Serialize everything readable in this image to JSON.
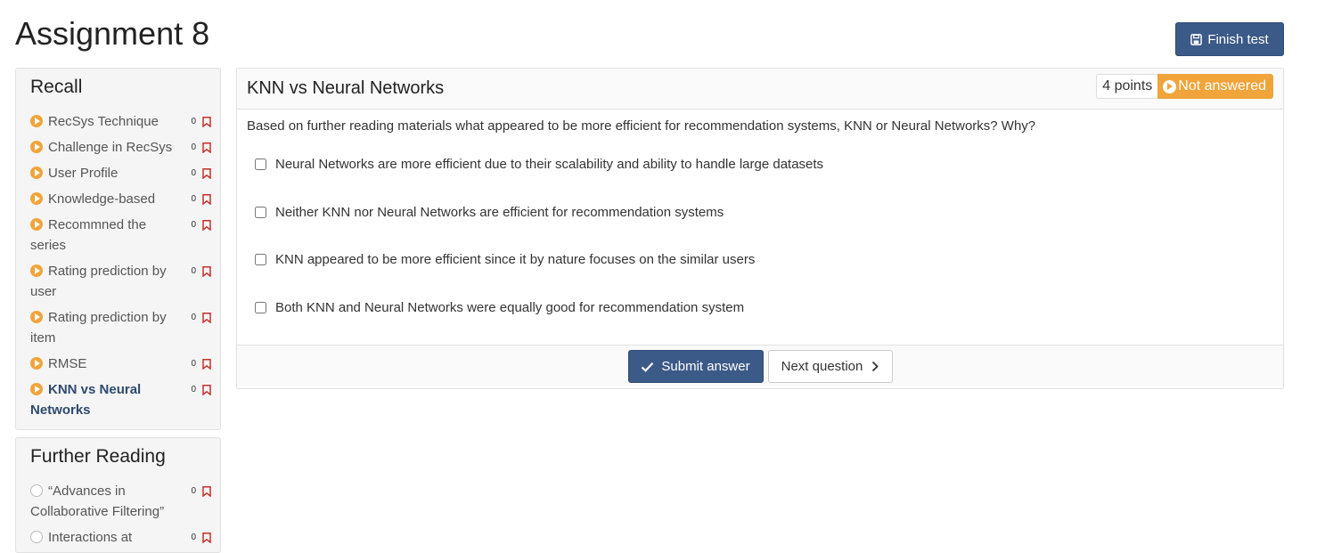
{
  "page": {
    "title": "Assignment 8",
    "finish_label": "Finish test"
  },
  "sidebar": {
    "recall": {
      "title": "Recall",
      "items": [
        {
          "label": "RecSys Technique",
          "count": "0",
          "status": "in-progress"
        },
        {
          "label": "Challenge in RecSys",
          "count": "0",
          "status": "in-progress"
        },
        {
          "label": "User Profile",
          "count": "0",
          "status": "in-progress"
        },
        {
          "label": "Knowledge-based",
          "count": "0",
          "status": "in-progress"
        },
        {
          "label": "Recommned the series",
          "count": "0",
          "status": "in-progress"
        },
        {
          "label": "Rating prediction by user",
          "count": "0",
          "status": "in-progress"
        },
        {
          "label": "Rating prediction by item",
          "count": "0",
          "status": "in-progress"
        },
        {
          "label": "RMSE",
          "count": "0",
          "status": "in-progress"
        },
        {
          "label": "KNN vs Neural Networks",
          "count": "0",
          "status": "in-progress"
        }
      ]
    },
    "further_reading": {
      "title": "Further Reading",
      "items": [
        {
          "label": "“Advances in Collaborative Filtering”",
          "count": "0",
          "status": "not-started"
        },
        {
          "label": "Interactions at",
          "count": "0",
          "status": "not-started"
        }
      ]
    }
  },
  "question": {
    "title": "KNN vs Neural Networks",
    "points": "4 points",
    "status": "Not answered",
    "text": "Based on further reading materials what appeared to be more efficient for recommendation systems, KNN or Neural Networks? Why?",
    "options": [
      {
        "label": "Neural Networks are more efficient due to their scalability and ability to handle large datasets",
        "checked": false
      },
      {
        "label": "Neither KNN nor Neural Networks are efficient for recommendation systems",
        "checked": false
      },
      {
        "label": "KNN appeared to be more efficient since it by nature focuses on the similar users",
        "checked": false
      },
      {
        "label": "Both KNN and Neural Networks were equally good for recommendation system",
        "checked": false
      }
    ],
    "submit_label": "Submit answer",
    "next_label": "Next question"
  },
  "colors": {
    "primary": "#3c5a87",
    "accent_orange": "#f0a43a",
    "bookmark_red": "#c9302c",
    "active_text": "#2f4a6e"
  }
}
